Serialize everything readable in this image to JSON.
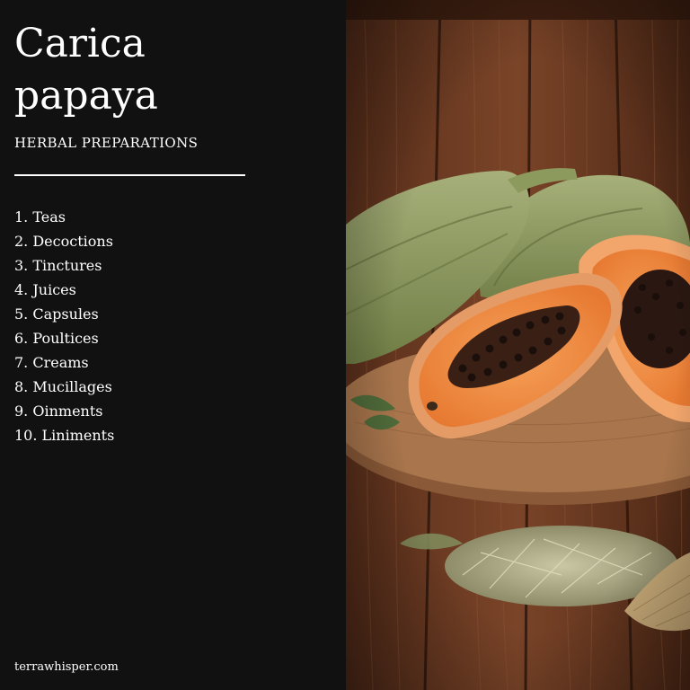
{
  "title_line1": "Carica",
  "title_line2": "papaya",
  "subtitle": "HERBAL PREPARATIONS",
  "items": [
    "1. Teas",
    "2. Decoctions",
    "3. Tinctures",
    "4. Juices",
    "5. Capsules",
    "6. Poultices",
    "7. Creams",
    "8. Mucillages",
    "9. Oinments",
    "10. Liniments"
  ],
  "footer": "terrawhisper.com",
  "colors": {
    "panel_bg": "#111111",
    "text": "#ffffff",
    "wood": "#6b3a22",
    "papaya_flesh": "#f08a3c",
    "papaya_skin": "#8a9a5b"
  }
}
